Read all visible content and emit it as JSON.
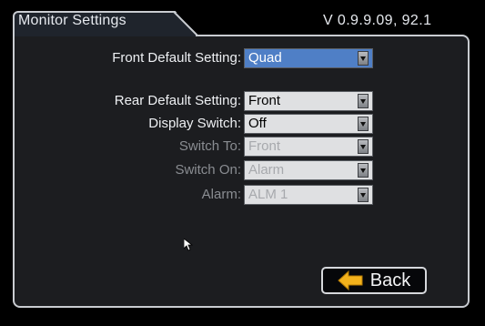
{
  "header": {
    "title": "Monitor Settings",
    "version": "V  0.9.9.09, 92.1"
  },
  "settings": [
    {
      "label": "Front Default Setting:",
      "value": "Quad",
      "state": "selected"
    },
    {
      "label": "Rear Default Setting:",
      "value": "Front",
      "state": "enabled"
    },
    {
      "label": "Display Switch:",
      "value": "Off",
      "state": "enabled"
    },
    {
      "label": "Switch To:",
      "value": "Front",
      "state": "disabled"
    },
    {
      "label": "Switch On:",
      "value": "Alarm",
      "state": "disabled"
    },
    {
      "label": "Alarm:",
      "value": "ALM 1",
      "state": "disabled"
    }
  ],
  "back_button": {
    "label": "Back",
    "icon": "arrow-left-icon",
    "icon_color": "#f3b21c"
  },
  "colors": {
    "highlight": "#4f7fc6",
    "background": "#1c1d20"
  }
}
